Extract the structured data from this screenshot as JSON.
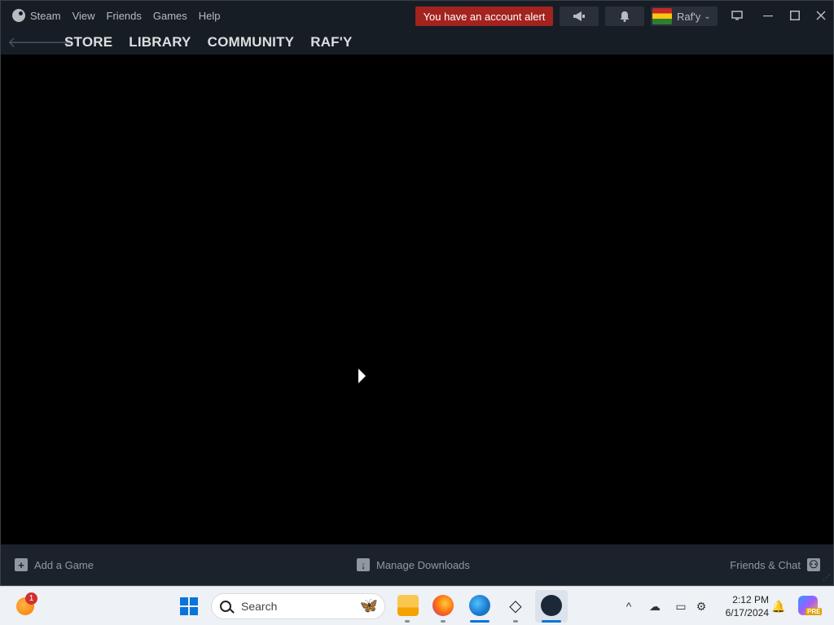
{
  "titlebar": {
    "menu": [
      {
        "label": "Steam"
      },
      {
        "label": "View"
      },
      {
        "label": "Friends"
      },
      {
        "label": "Games"
      },
      {
        "label": "Help"
      }
    ],
    "alert_label": "You have an account alert",
    "user_name": "Raf'y",
    "icons": {
      "announcements": "megaphone-icon",
      "notifications": "bell-icon",
      "big_picture": "monitor-icon"
    }
  },
  "nav": {
    "tabs": [
      {
        "label": "STORE"
      },
      {
        "label": "LIBRARY"
      },
      {
        "label": "COMMUNITY"
      },
      {
        "label": "RAF'Y"
      }
    ]
  },
  "bottombar": {
    "add_game": "Add a Game",
    "manage_downloads": "Manage Downloads",
    "friends_chat": "Friends & Chat"
  },
  "taskbar": {
    "widget_badge": "1",
    "search_placeholder": "Search",
    "apps": [
      "file-explorer-icon",
      "firefox-icon",
      "internet-download-manager-icon",
      "unity-icon",
      "steam-icon"
    ],
    "clock_time": "2:12 PM",
    "clock_date": "6/17/2024",
    "copilot_badge": "PRE"
  },
  "colors": {
    "window_bg": "#171d25",
    "alert_bg": "#a3231f",
    "taskbar_bg": "#eef1f6",
    "accent": "#0a74d9"
  }
}
